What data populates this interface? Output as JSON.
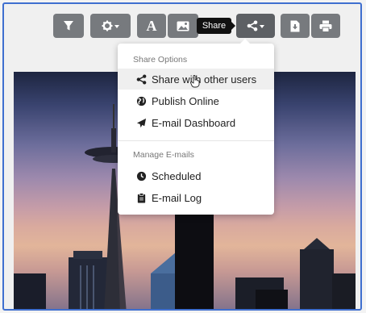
{
  "toolbar": {
    "buttons": [
      {
        "name": "filter-button",
        "icon": "filter-icon"
      },
      {
        "name": "settings-button",
        "icon": "gear-icon"
      },
      {
        "name": "text-button",
        "label": "A"
      },
      {
        "name": "image-button",
        "icon": "image-icon"
      },
      {
        "name": "share-button",
        "icon": "share-icon"
      },
      {
        "name": "export-button",
        "icon": "file-download-icon"
      },
      {
        "name": "print-button",
        "icon": "printer-icon"
      }
    ],
    "tooltip": "Share"
  },
  "menu": {
    "share_header": "Share Options",
    "items_share": [
      {
        "label": "Share with other users",
        "icon": "share-icon"
      },
      {
        "label": "Publish Online",
        "icon": "globe-icon"
      },
      {
        "label": "E-mail Dashboard",
        "icon": "paper-plane-icon"
      }
    ],
    "email_header": "Manage E-mails",
    "items_email": [
      {
        "label": "Scheduled",
        "icon": "clock-icon"
      },
      {
        "label": "E-mail Log",
        "icon": "clipboard-icon"
      }
    ]
  },
  "colors": {
    "toolbar_button": "#777a7e",
    "frame_border": "#3f6fcf",
    "menu_hover": "#efefef"
  }
}
